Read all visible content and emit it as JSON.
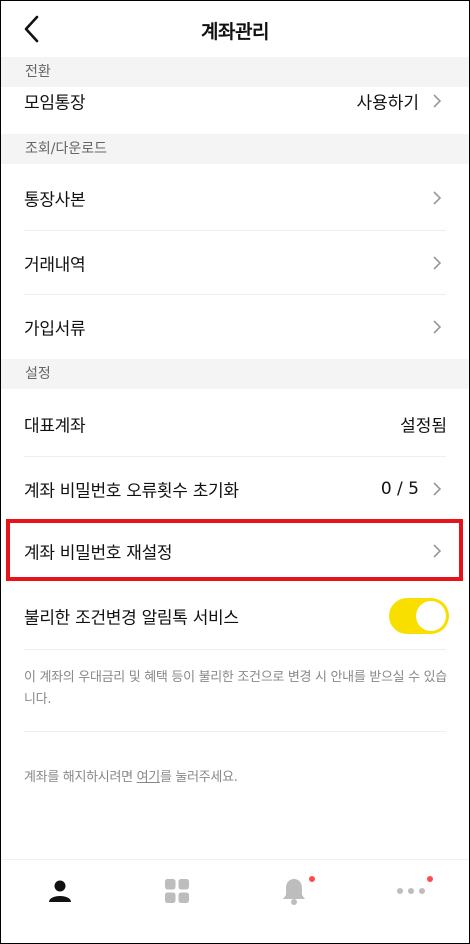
{
  "header": {
    "title": "계좌관리"
  },
  "sections": [
    {
      "title": "전환"
    },
    {
      "title": "조회/다운로드"
    },
    {
      "title": "설정"
    }
  ],
  "rows": {
    "group_account": {
      "label": "모임통장",
      "value": "사용하기"
    },
    "passbook_copy": {
      "label": "통장사본"
    },
    "transactions": {
      "label": "거래내역"
    },
    "join_documents": {
      "label": "가입서류"
    },
    "primary_account": {
      "label": "대표계좌",
      "value": "설정됨"
    },
    "password_error_reset": {
      "label": "계좌 비밀번호 오류횟수 초기화",
      "value": "0 / 5"
    },
    "password_reset": {
      "label": "계좌 비밀번호 재설정"
    },
    "unfavorable_alert": {
      "label": "불리한 조건변경 알림톡 서비스",
      "toggle_on": true
    }
  },
  "notice": "이 계좌의 우대금리 및 혜택 등이 불리한 조건으로 변경 시 안내를 받으실 수 있습니다.",
  "cancel": {
    "prefix": "계좌를 해지하시려면 ",
    "link": "여기",
    "suffix": "를 눌러주세요."
  },
  "tabbar": {
    "tabs": [
      {
        "icon": "person-icon",
        "active": true
      },
      {
        "icon": "grid-icon",
        "active": false
      },
      {
        "icon": "bell-icon",
        "active": false,
        "badge": true
      },
      {
        "icon": "more-icon",
        "active": false,
        "badge": true
      }
    ]
  },
  "colors": {
    "accent_toggle": "#f8df00",
    "highlight": "#e6131b",
    "badge": "#ff4d4d"
  }
}
